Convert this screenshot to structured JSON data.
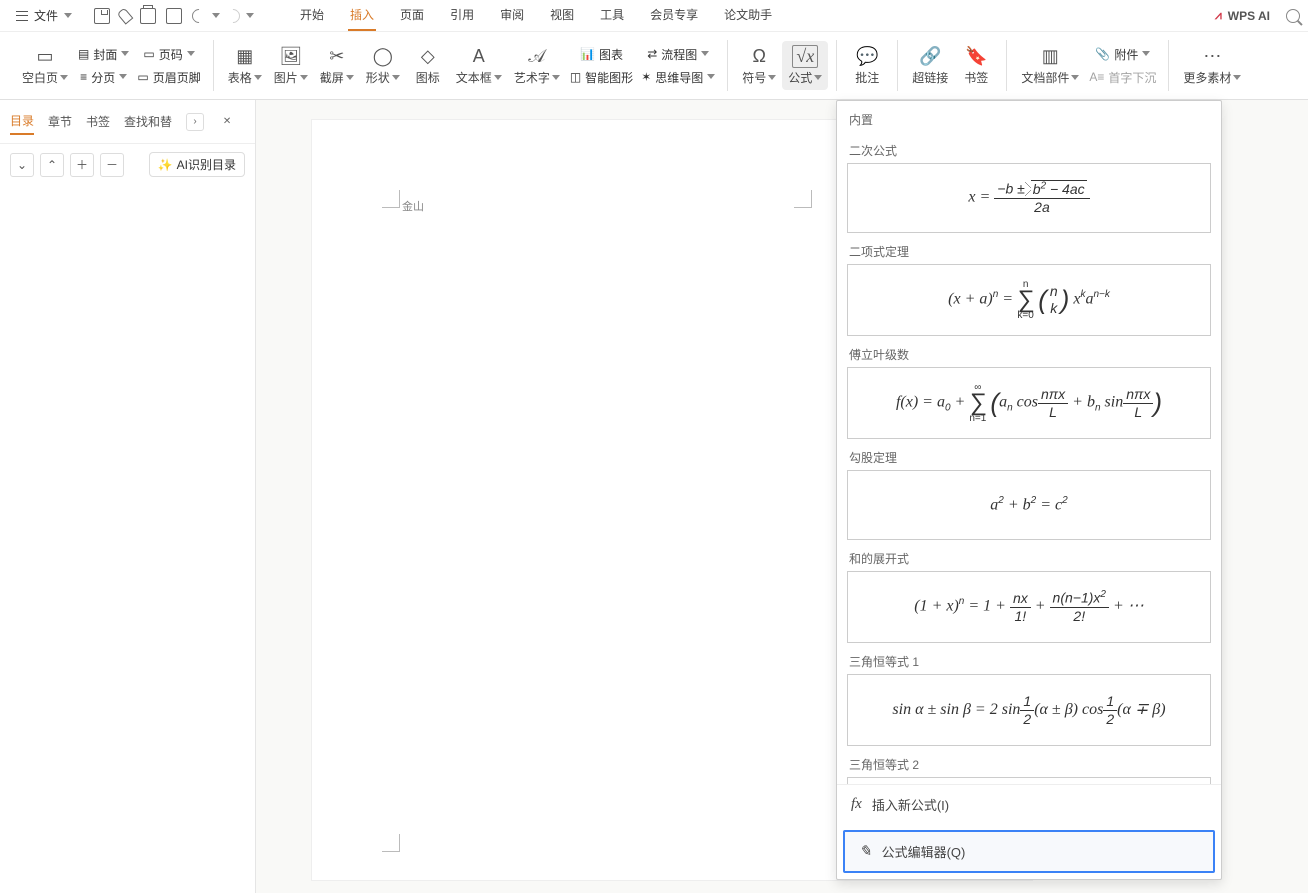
{
  "menubar": {
    "file": "文件",
    "tabs": [
      "开始",
      "插入",
      "页面",
      "引用",
      "审阅",
      "视图",
      "工具",
      "会员专享",
      "论文助手"
    ],
    "active_tab_index": 1,
    "wpsai": "WPS AI"
  },
  "ribbon": {
    "blank_page": "空白页",
    "cover": "封面",
    "page_number": "页码",
    "section": "分页",
    "header_footer": "页眉页脚",
    "table": "表格",
    "picture": "图片",
    "screenshot": "截屏",
    "shapes": "形状",
    "icons": "图标",
    "textbox": "文本框",
    "wordart": "艺术字",
    "chart": "图表",
    "flowchart": "流程图",
    "smartart": "智能图形",
    "mindmap": "思维导图",
    "symbol": "符号",
    "equation": "公式",
    "comment": "批注",
    "hyperlink": "超链接",
    "bookmark": "书签",
    "docparts": "文档部件",
    "attachment": "附件",
    "dropcap": "首字下沉",
    "more": "更多素材"
  },
  "sidebar": {
    "tabs": [
      "目录",
      "章节",
      "书签",
      "查找和替"
    ],
    "active_tab_index": 0,
    "ai_toc": "AI识别目录"
  },
  "document": {
    "header_text": "金山"
  },
  "dropdown": {
    "builtin_header": "内置",
    "equations": [
      {
        "label": "二次公式",
        "key": "quadratic"
      },
      {
        "label": "二项式定理",
        "key": "binomial"
      },
      {
        "label": "傅立叶级数",
        "key": "fourier"
      },
      {
        "label": "勾股定理",
        "key": "pythagoras"
      },
      {
        "label": "和的展开式",
        "key": "taylor"
      },
      {
        "label": "三角恒等式 1",
        "key": "trig1"
      },
      {
        "label": "三角恒等式 2",
        "key": "trig2"
      }
    ],
    "insert_new": "插入新公式(I)",
    "editor": "公式编辑器(Q)"
  }
}
